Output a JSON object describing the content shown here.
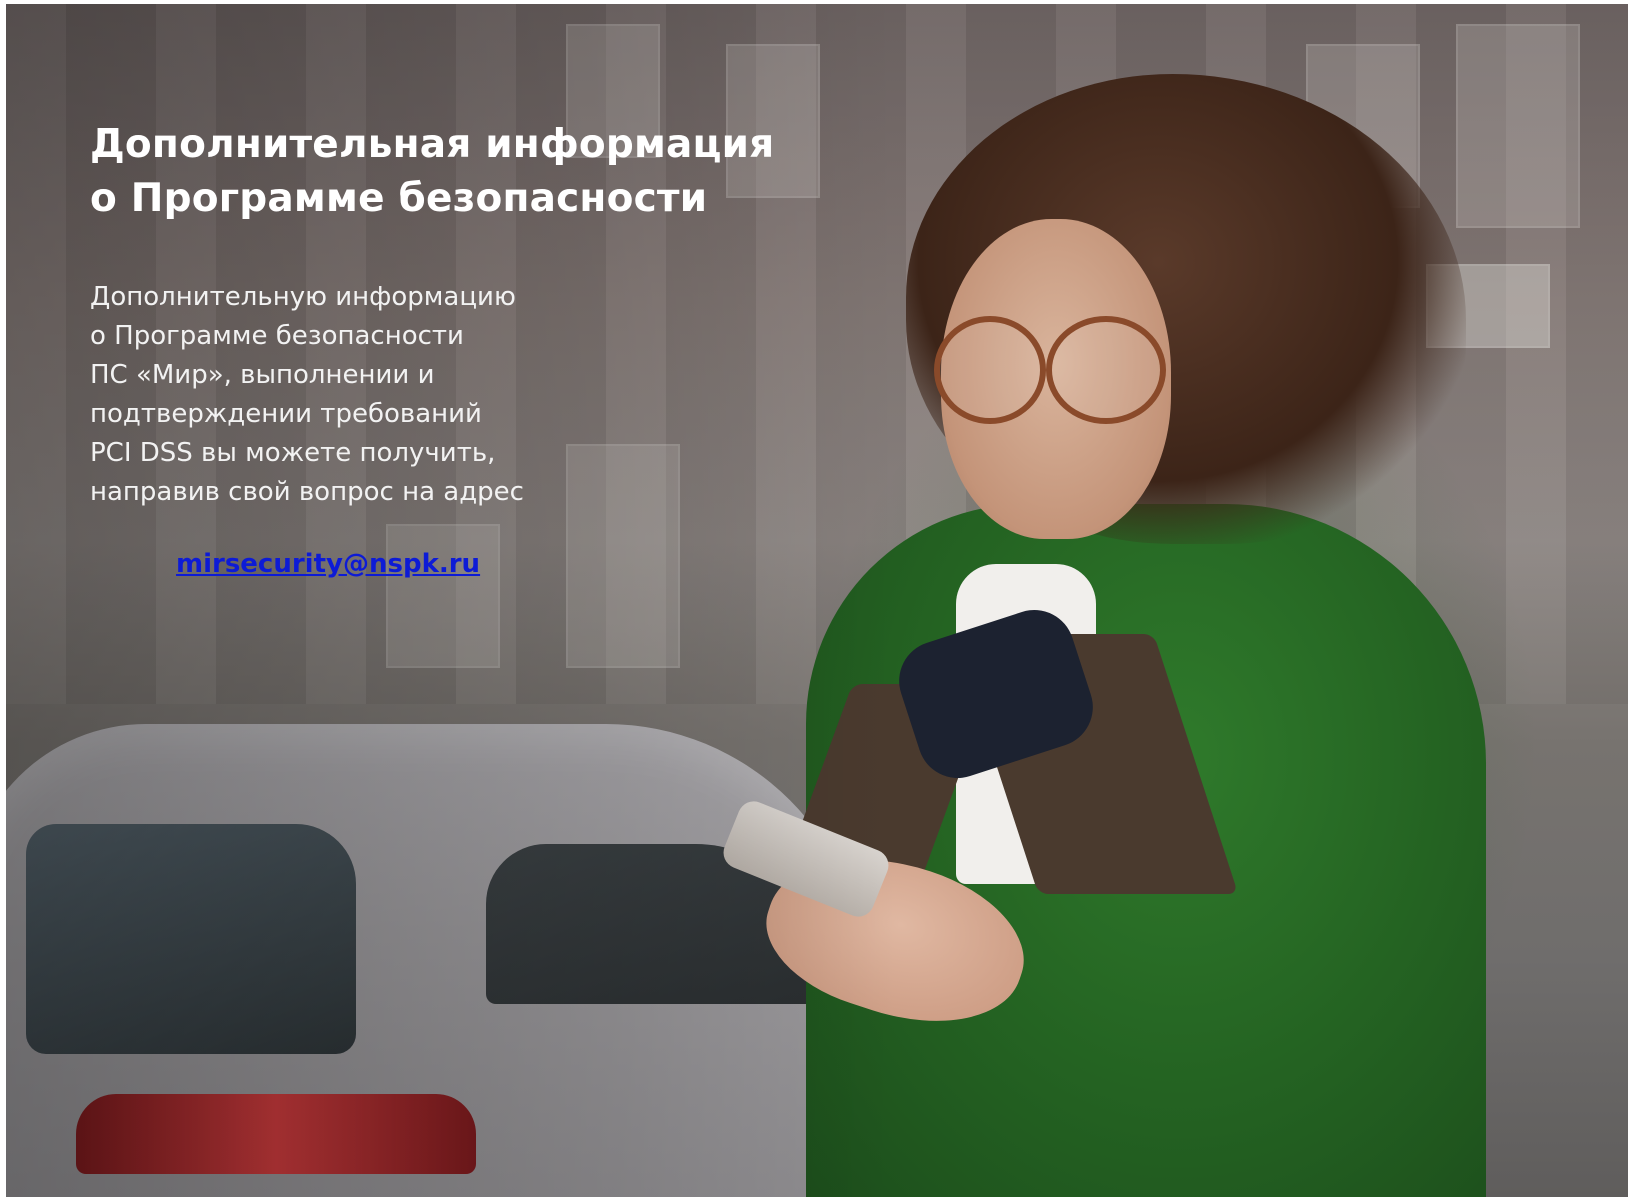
{
  "slide": {
    "title_line_1": "Дополнительная информация",
    "title_line_2": "о Программе безопасности",
    "body_lines": [
      "Дополнительную информацию",
      "о Программе безопасности",
      "ПС «Мир», выполнении и",
      "подтверждении требований",
      "PCI DSS вы можете получить,",
      "направив свой вопрос на адрес"
    ],
    "email": "mirsecurity@nspk.ru"
  },
  "colors": {
    "title": "#ffffff",
    "body": "#f2f2f2",
    "link": "#0d1bd6"
  }
}
